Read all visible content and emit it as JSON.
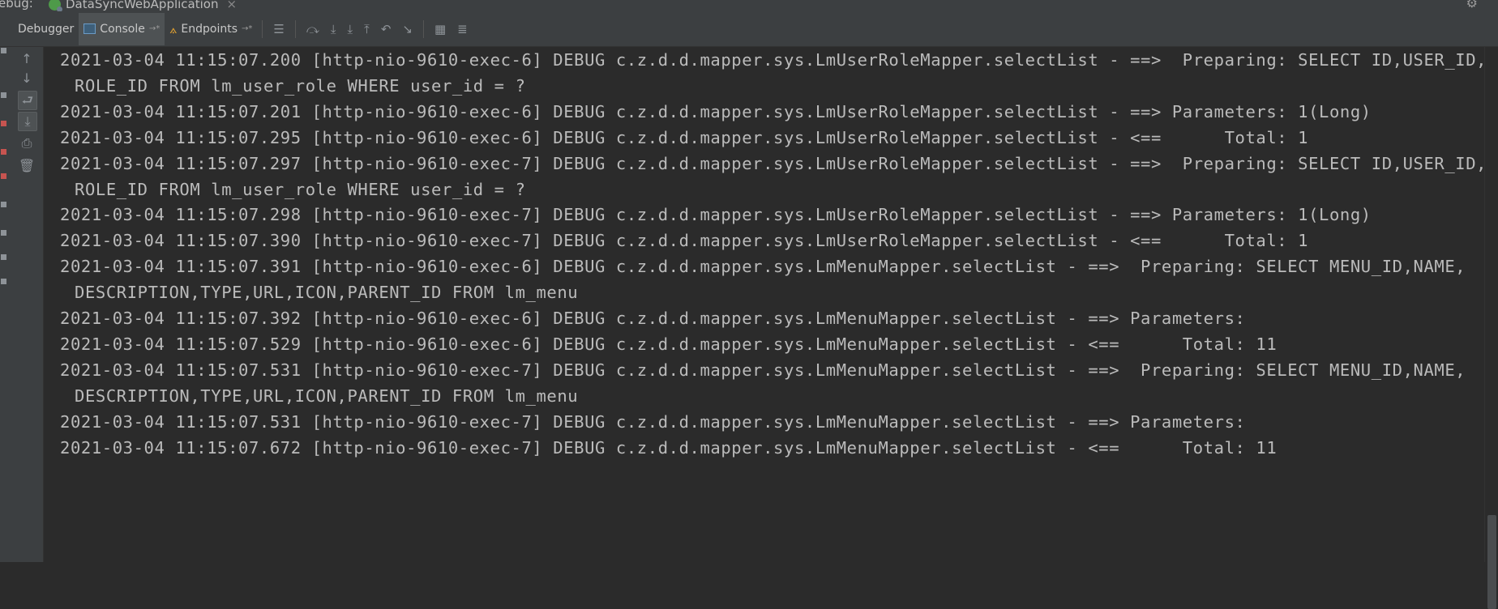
{
  "titlebar": {
    "debug_label": "ebug:",
    "app_tab": "DataSyncWebApplication",
    "close": "×",
    "settings_icon": "gear-icon",
    "minimize_icon": "minus-icon"
  },
  "toolbar": {
    "tabs": [
      {
        "label": "Debugger"
      },
      {
        "label": "Console",
        "pin": "→*"
      },
      {
        "label": "Endpoints",
        "pin": "→*"
      }
    ],
    "icons": [
      "menu-icon",
      "step-over-icon",
      "step-into-icon",
      "force-step-into-icon",
      "step-out-icon",
      "drop-frame-icon",
      "run-to-cursor-icon",
      "evaluate-icon",
      "trace-icon"
    ]
  },
  "sidebar": {
    "icons": [
      "up-arrow-icon",
      "down-arrow-icon",
      "soft-wrap-icon",
      "scroll-to-end-icon",
      "print-icon",
      "trash-icon"
    ]
  },
  "console": {
    "lines": [
      {
        "text": "2021-03-04 11:15:07.200 [http-nio-9610-exec-6] DEBUG c.z.d.d.mapper.sys.LmUserRoleMapper.selectList - ==>  Preparing: SELECT ID,USER_ID,"
      },
      {
        "text": "ROLE_ID FROM lm_user_role WHERE user_id = ?",
        "cont": true
      },
      {
        "text": "2021-03-04 11:15:07.201 [http-nio-9610-exec-6] DEBUG c.z.d.d.mapper.sys.LmUserRoleMapper.selectList - ==> Parameters: 1(Long)"
      },
      {
        "text": "2021-03-04 11:15:07.295 [http-nio-9610-exec-6] DEBUG c.z.d.d.mapper.sys.LmUserRoleMapper.selectList - <==      Total: 1"
      },
      {
        "text": "2021-03-04 11:15:07.297 [http-nio-9610-exec-7] DEBUG c.z.d.d.mapper.sys.LmUserRoleMapper.selectList - ==>  Preparing: SELECT ID,USER_ID,"
      },
      {
        "text": "ROLE_ID FROM lm_user_role WHERE user_id = ?",
        "cont": true
      },
      {
        "text": "2021-03-04 11:15:07.298 [http-nio-9610-exec-7] DEBUG c.z.d.d.mapper.sys.LmUserRoleMapper.selectList - ==> Parameters: 1(Long)"
      },
      {
        "text": "2021-03-04 11:15:07.390 [http-nio-9610-exec-7] DEBUG c.z.d.d.mapper.sys.LmUserRoleMapper.selectList - <==      Total: 1"
      },
      {
        "text": "2021-03-04 11:15:07.391 [http-nio-9610-exec-6] DEBUG c.z.d.d.mapper.sys.LmMenuMapper.selectList - ==>  Preparing: SELECT MENU_ID,NAME,"
      },
      {
        "text": "DESCRIPTION,TYPE,URL,ICON,PARENT_ID FROM lm_menu",
        "cont": true
      },
      {
        "text": "2021-03-04 11:15:07.392 [http-nio-9610-exec-6] DEBUG c.z.d.d.mapper.sys.LmMenuMapper.selectList - ==> Parameters: "
      },
      {
        "text": "2021-03-04 11:15:07.529 [http-nio-9610-exec-6] DEBUG c.z.d.d.mapper.sys.LmMenuMapper.selectList - <==      Total: 11"
      },
      {
        "text": "2021-03-04 11:15:07.531 [http-nio-9610-exec-7] DEBUG c.z.d.d.mapper.sys.LmMenuMapper.selectList - ==>  Preparing: SELECT MENU_ID,NAME,"
      },
      {
        "text": "DESCRIPTION,TYPE,URL,ICON,PARENT_ID FROM lm_menu",
        "cont": true
      },
      {
        "text": "2021-03-04 11:15:07.531 [http-nio-9610-exec-7] DEBUG c.z.d.d.mapper.sys.LmMenuMapper.selectList - ==> Parameters: "
      },
      {
        "text": "2021-03-04 11:15:07.672 [http-nio-9610-exec-7] DEBUG c.z.d.d.mapper.sys.LmMenuMapper.selectList - <==      Total: 11"
      }
    ]
  },
  "colors": {
    "console_bg": "#2b2b2b",
    "panel_bg": "#3c3f41",
    "text": "#bbbbbb",
    "active_tab": "#4e5254"
  }
}
